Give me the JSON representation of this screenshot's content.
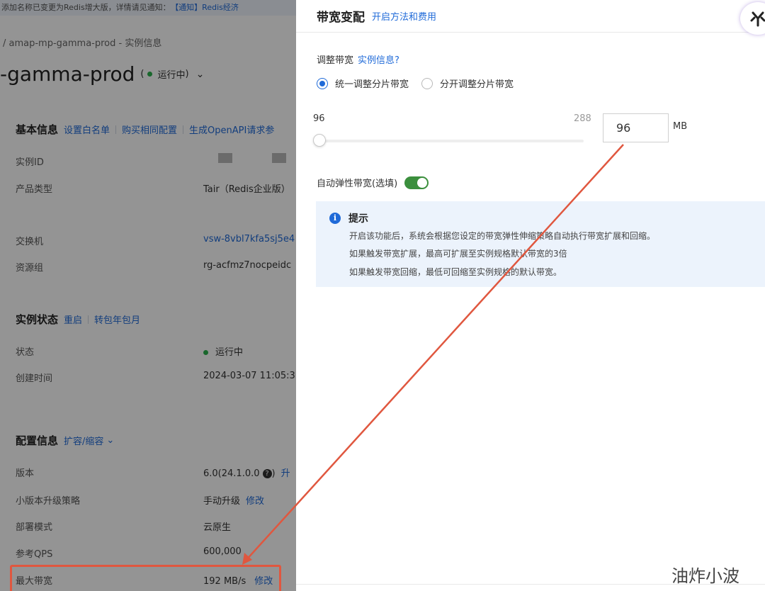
{
  "background_page": {
    "notice": {
      "text": "添加名称已变更为Redis增大版，详情请见通知：",
      "link": "【通知】Redis经济"
    },
    "breadcrumb": "/   amap-mp-gamma-prod - 实例信息",
    "title": "-gamma-prod",
    "title_status": "运行中",
    "basic_info": {
      "heading": "基本信息",
      "actions": [
        "设置白名单",
        "购买相同配置",
        "生成OpenAPI请求参"
      ],
      "rows": [
        {
          "label": "实例ID",
          "value": ""
        },
        {
          "label": "产品类型",
          "value": "Tair（Redis企业版）"
        },
        {
          "label": "交换机",
          "value": "vsw-8vbl7kfa5sj5e4"
        },
        {
          "label": "资源组",
          "value": "rg-acfmz7nocpeidc"
        }
      ]
    },
    "instance_status": {
      "heading": "实例状态",
      "actions": [
        "重启",
        "转包年包月"
      ],
      "rows": [
        {
          "label": "状态",
          "value": "运行中"
        },
        {
          "label": "创建时间",
          "value": "2024-03-07 11:05:3"
        }
      ]
    },
    "config_info": {
      "heading": "配置信息",
      "action": "扩容/缩容",
      "rows": [
        {
          "label": "版本",
          "value": "6.0(24.1.0.0",
          "extra": "升"
        },
        {
          "label": "小版本升级策略",
          "value": "手动升级",
          "edit": "修改"
        },
        {
          "label": "部署模式",
          "value": "云原生"
        },
        {
          "label": "参考QPS",
          "value": "600,000"
        },
        {
          "label": "最大带宽",
          "value": "192 MB/s",
          "edit": "修改"
        }
      ]
    }
  },
  "drawer": {
    "title": "带宽变配",
    "title_link": "开启方法和费用",
    "adjust_label": "调整带宽",
    "adjust_link": "实例信息?",
    "radios": [
      {
        "label": "统一调整分片带宽",
        "checked": true
      },
      {
        "label": "分开调整分片带宽",
        "checked": false
      }
    ],
    "slider": {
      "min": "96",
      "max": "288",
      "value": 96
    },
    "input_value": "96",
    "unit": "MB",
    "auto_label": "自动弹性带宽(选填)",
    "auto_on": true,
    "tip": {
      "title": "提示",
      "lines": [
        "开启该功能后，系统会根据您设定的带宽弹性伸缩策略自动执行带宽扩展和回缩。",
        "如果触发带宽扩展，最高可扩展至实例规格默认带宽的3倍",
        "如果触发带宽回缩，最低可回缩至实例规格的默认带宽。"
      ]
    }
  },
  "watermark": "油炸小波",
  "colors": {
    "accent": "#1f6ad8",
    "status_green": "#2bb24c",
    "annotation_red": "#e0573f",
    "toggle_green": "#3b8f3d"
  }
}
